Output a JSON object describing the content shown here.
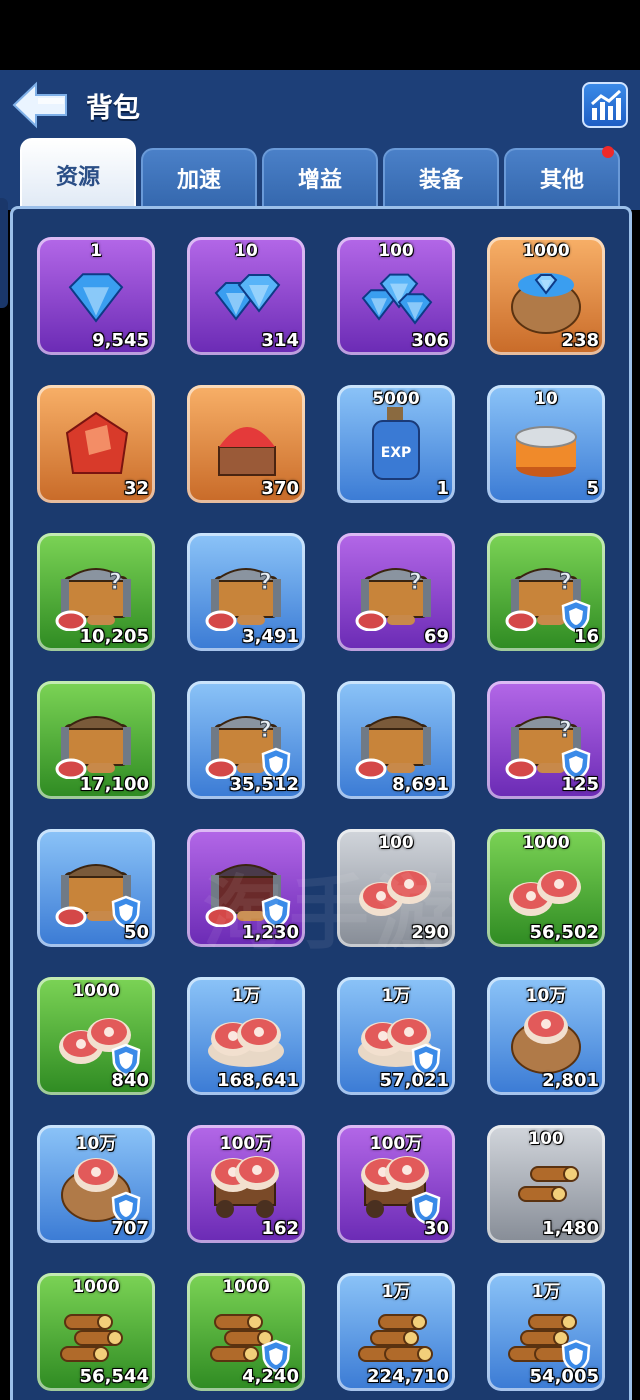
{
  "header": {
    "title": "背包"
  },
  "tabs": [
    {
      "label": "资源",
      "active": true
    },
    {
      "label": "加速",
      "active": false
    },
    {
      "label": "增益",
      "active": false
    },
    {
      "label": "装备",
      "active": false
    },
    {
      "label": "其他",
      "active": false,
      "badge": true
    }
  ],
  "colors": {
    "header_bg": "#1d3f78",
    "panel_bg": "#1b3a6e",
    "badge": "#ee2a2a"
  },
  "items": [
    {
      "icon": "diamond-icon",
      "rarity": "purple",
      "label": "1",
      "count": "9,545"
    },
    {
      "icon": "diamonds-icon",
      "rarity": "purple",
      "label": "10",
      "count": "314"
    },
    {
      "icon": "diamond-pile-icon",
      "rarity": "purple",
      "label": "100",
      "count": "306"
    },
    {
      "icon": "diamond-sack-icon",
      "rarity": "orange",
      "label": "1000",
      "count": "238"
    },
    {
      "icon": "red-crystal-icon",
      "rarity": "orange",
      "label": "",
      "count": "32"
    },
    {
      "icon": "crystal-cart-icon",
      "rarity": "orange",
      "label": "",
      "count": "370"
    },
    {
      "icon": "exp-bottle-icon",
      "rarity": "blue",
      "label": "5000",
      "count": "1"
    },
    {
      "icon": "can-icon",
      "rarity": "blue",
      "label": "10",
      "count": "5"
    },
    {
      "icon": "mystery-chest-icon",
      "rarity": "green",
      "label": "",
      "count": "10,205"
    },
    {
      "icon": "mystery-chest-icon",
      "rarity": "blue",
      "label": "",
      "count": "3,491"
    },
    {
      "icon": "mystery-chest-icon",
      "rarity": "purple",
      "label": "",
      "count": "69"
    },
    {
      "icon": "mystery-chest-icon",
      "rarity": "green",
      "label": "",
      "count": "16",
      "shield": true
    },
    {
      "icon": "resource-chest-icon",
      "rarity": "green",
      "label": "",
      "count": "17,100"
    },
    {
      "icon": "mystery-chest-icon",
      "rarity": "blue",
      "label": "",
      "count": "35,512",
      "shield": true
    },
    {
      "icon": "resource-chest-icon",
      "rarity": "blue",
      "label": "",
      "count": "8,691"
    },
    {
      "icon": "mystery-chest-icon",
      "rarity": "purple",
      "label": "",
      "count": "125",
      "shield": true
    },
    {
      "icon": "resource-chest-icon",
      "rarity": "blue",
      "label": "",
      "count": "50",
      "shield": true
    },
    {
      "icon": "dark-chest-icon",
      "rarity": "purple",
      "label": "",
      "count": "1,230",
      "shield": true
    },
    {
      "icon": "meat-icon",
      "rarity": "grey",
      "label": "100",
      "count": "290"
    },
    {
      "icon": "meat-icon",
      "rarity": "green",
      "label": "1000",
      "count": "56,502"
    },
    {
      "icon": "meat-icon",
      "rarity": "green",
      "label": "1000",
      "count": "840",
      "shield": true
    },
    {
      "icon": "meat-plate-icon",
      "rarity": "blue",
      "label": "1万",
      "count": "168,641"
    },
    {
      "icon": "meat-plate-icon",
      "rarity": "blue",
      "label": "1万",
      "count": "57,021",
      "shield": true
    },
    {
      "icon": "meat-sack-icon",
      "rarity": "blue",
      "label": "10万",
      "count": "2,801"
    },
    {
      "icon": "meat-sack-icon",
      "rarity": "blue",
      "label": "10万",
      "count": "707",
      "shield": true
    },
    {
      "icon": "meat-cart-icon",
      "rarity": "purple",
      "label": "100万",
      "count": "162"
    },
    {
      "icon": "meat-cart-icon",
      "rarity": "purple",
      "label": "100万",
      "count": "30",
      "shield": true
    },
    {
      "icon": "wood-icon",
      "rarity": "grey",
      "label": "100",
      "count": "1,480"
    },
    {
      "icon": "wood-pile-icon",
      "rarity": "green",
      "label": "1000",
      "count": "56,544"
    },
    {
      "icon": "wood-pile-icon",
      "rarity": "green",
      "label": "1000",
      "count": "4,240",
      "shield": true
    },
    {
      "icon": "wood-stack-icon",
      "rarity": "blue",
      "label": "1万",
      "count": "224,710"
    },
    {
      "icon": "wood-stack-icon",
      "rarity": "blue",
      "label": "1万",
      "count": "54,005",
      "shield": true
    }
  ]
}
